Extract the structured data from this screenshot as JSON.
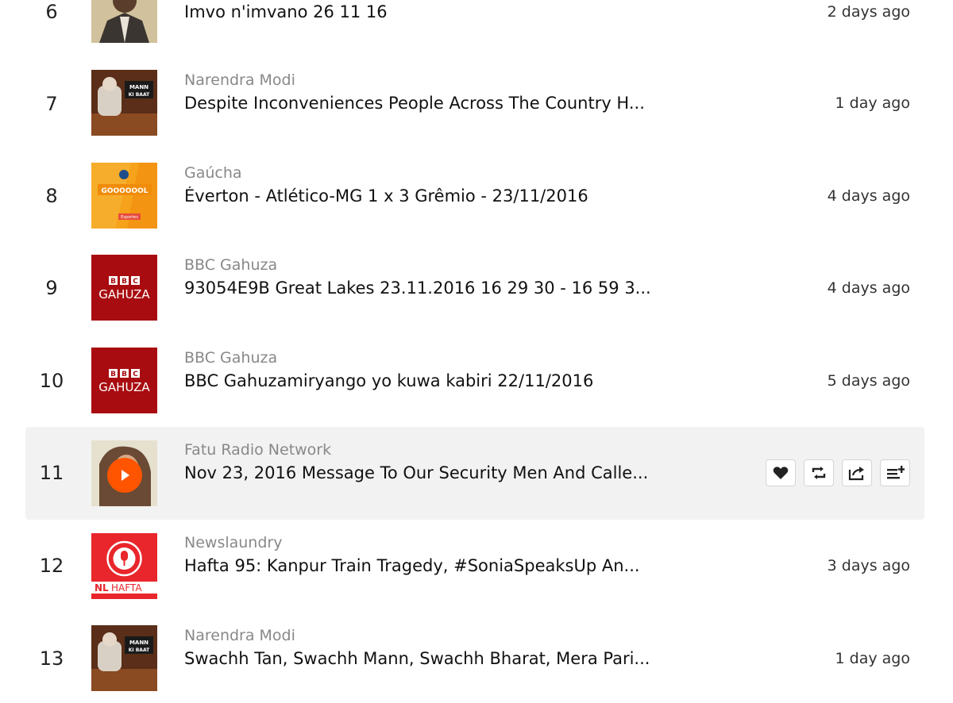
{
  "tracks": [
    {
      "rank": "6",
      "user": "",
      "title": "Imvo n'imvano 26 11 16",
      "time": "2 days ago",
      "artwork": "person-photo-artwork"
    },
    {
      "rank": "7",
      "user": "Narendra Modi",
      "title": "Despite Inconveniences People Across The Country H...",
      "time": "1 day ago",
      "artwork": "mann-ki-baat-artwork",
      "art_text": "MANN KI BAAT"
    },
    {
      "rank": "8",
      "user": "Gaúcha",
      "title": "Éverton - Atlético-MG 1 x 3 Grêmio - 23/11/2016",
      "time": "4 days ago",
      "artwork": "goooool-artwork",
      "art_text": "GOOOOOOL"
    },
    {
      "rank": "9",
      "user": "BBC Gahuza",
      "title": "93054E9B Great Lakes 23.11.2016 16 29 30 - 16 59 3...",
      "time": "4 days ago",
      "artwork": "bbc-gahuza-artwork",
      "art_text": "GAHUZA"
    },
    {
      "rank": "10",
      "user": "BBC Gahuza",
      "title": "BBC Gahuzamiryango yo kuwa kabiri 22/11/2016",
      "time": "5 days ago",
      "artwork": "bbc-gahuza-artwork",
      "art_text": "GAHUZA"
    },
    {
      "rank": "11",
      "user": "Fatu Radio Network",
      "title": "Nov 23, 2016 Message To Our Security Men And Calle...",
      "time": "",
      "artwork": "fatu-radio-artwork",
      "hovered": true
    },
    {
      "rank": "12",
      "user": "Newslaundry",
      "title": "Hafta 95: Kanpur Train Tragedy, #SoniaSpeaksUp An...",
      "time": "3 days ago",
      "artwork": "nl-hafta-artwork",
      "art_text": "NL HAFTA"
    },
    {
      "rank": "13",
      "user": "Narendra Modi",
      "title": "Swachh Tan, Swachh Mann, Swachh Bharat, Mera Pari...",
      "time": "1 day ago",
      "artwork": "mann-ki-baat-artwork",
      "art_text": "MANN KI BAAT"
    }
  ],
  "icons": {
    "like": "heart-icon",
    "repost": "repost-icon",
    "share": "share-icon",
    "playlist": "add-to-playlist-icon",
    "play": "play-icon"
  },
  "colors": {
    "accent": "#ff5500",
    "bbc_red": "#a80c10",
    "goool_orange": "#f6a21a",
    "nl_red": "#e8262b"
  }
}
